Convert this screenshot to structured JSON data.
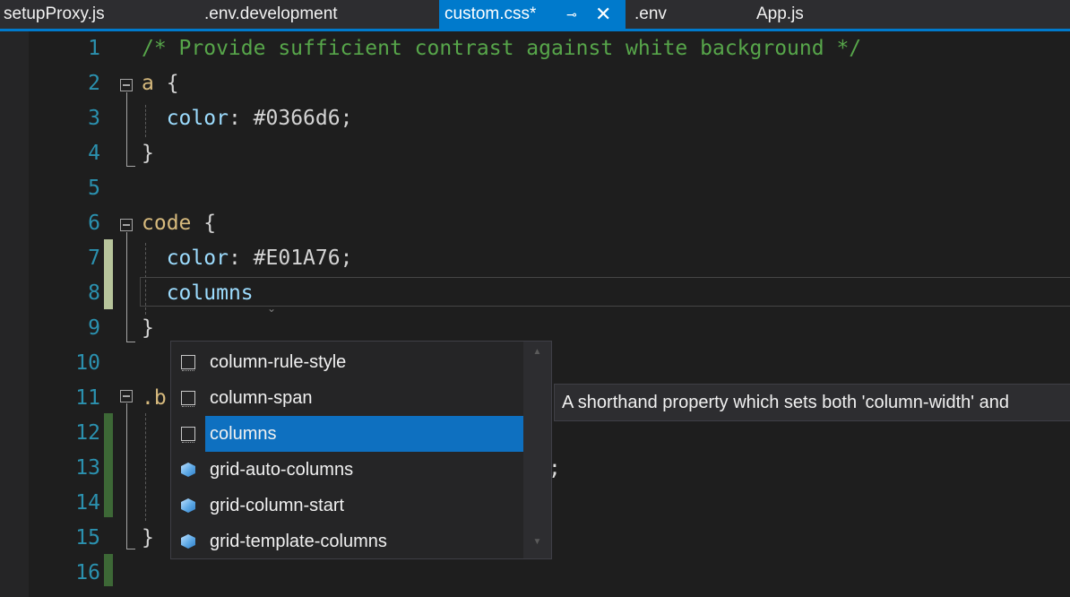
{
  "tabs": [
    {
      "label": "setupProxy.js",
      "active": false
    },
    {
      "label": ".env.development",
      "active": false
    },
    {
      "label": "custom.css*",
      "active": true,
      "pin_icon": "pin-icon",
      "close_icon": "close-icon"
    },
    {
      "label": ".env",
      "active": false
    },
    {
      "label": "App.js",
      "active": false
    }
  ],
  "tab_symbols": {
    "pin": "⊸",
    "close": "✕"
  },
  "editor": {
    "lines": [
      {
        "n": "1",
        "tokens": [
          {
            "t": "/* Provide sufficient contrast against white background */",
            "c": "cm"
          }
        ]
      },
      {
        "n": "2",
        "tokens": [
          {
            "t": "a ",
            "c": "sel"
          },
          {
            "t": "{",
            "c": "val"
          }
        ]
      },
      {
        "n": "3",
        "tokens": [
          {
            "t": "  ",
            "c": "val"
          },
          {
            "t": "color",
            "c": "prop"
          },
          {
            "t": ": #0366d6;",
            "c": "val"
          }
        ]
      },
      {
        "n": "4",
        "tokens": [
          {
            "t": "}",
            "c": "val"
          }
        ]
      },
      {
        "n": "5",
        "tokens": []
      },
      {
        "n": "6",
        "tokens": [
          {
            "t": "code ",
            "c": "sel"
          },
          {
            "t": "{",
            "c": "val"
          }
        ]
      },
      {
        "n": "7",
        "tokens": [
          {
            "t": "  ",
            "c": "val"
          },
          {
            "t": "color",
            "c": "prop"
          },
          {
            "t": ": #E01A76;",
            "c": "val"
          }
        ]
      },
      {
        "n": "8",
        "tokens": [
          {
            "t": "  ",
            "c": "val"
          },
          {
            "t": "columns",
            "c": "prop"
          }
        ]
      },
      {
        "n": "9",
        "tokens": [
          {
            "t": "}",
            "c": "val"
          }
        ]
      },
      {
        "n": "10",
        "tokens": []
      },
      {
        "n": "11",
        "tokens": [
          {
            "t": ".b",
            "c": "sel"
          }
        ]
      },
      {
        "n": "12",
        "tokens": []
      },
      {
        "n": "13",
        "tokens": []
      },
      {
        "n": "14",
        "tokens": []
      },
      {
        "n": "15",
        "tokens": [
          {
            "t": "}",
            "c": "val"
          }
        ]
      },
      {
        "n": "16",
        "tokens": []
      }
    ],
    "partial_line_13_tail": ";"
  },
  "completion": {
    "items": [
      {
        "label": "column-rule-style",
        "icon": "property-icon",
        "kind": "box",
        "selected": false
      },
      {
        "label": "column-span",
        "icon": "property-icon",
        "kind": "box",
        "selected": false
      },
      {
        "label": "columns",
        "icon": "property-icon",
        "kind": "box",
        "selected": true
      },
      {
        "label": "grid-auto-columns",
        "icon": "cube-icon",
        "kind": "cube",
        "selected": false
      },
      {
        "label": "grid-column-start",
        "icon": "cube-icon",
        "kind": "cube",
        "selected": false
      },
      {
        "label": "grid-template-columns",
        "icon": "cube-icon",
        "kind": "cube",
        "selected": false
      }
    ],
    "scroll_up": "▲",
    "scroll_down": "▼"
  },
  "tooltip": {
    "text": "A shorthand property which sets both 'column-width' and"
  },
  "colors": {
    "accent": "#007acc",
    "selection": "#0e70c0",
    "line_numbers": "#2b91af",
    "comment": "#57a64a",
    "property": "#9cdcfe"
  }
}
